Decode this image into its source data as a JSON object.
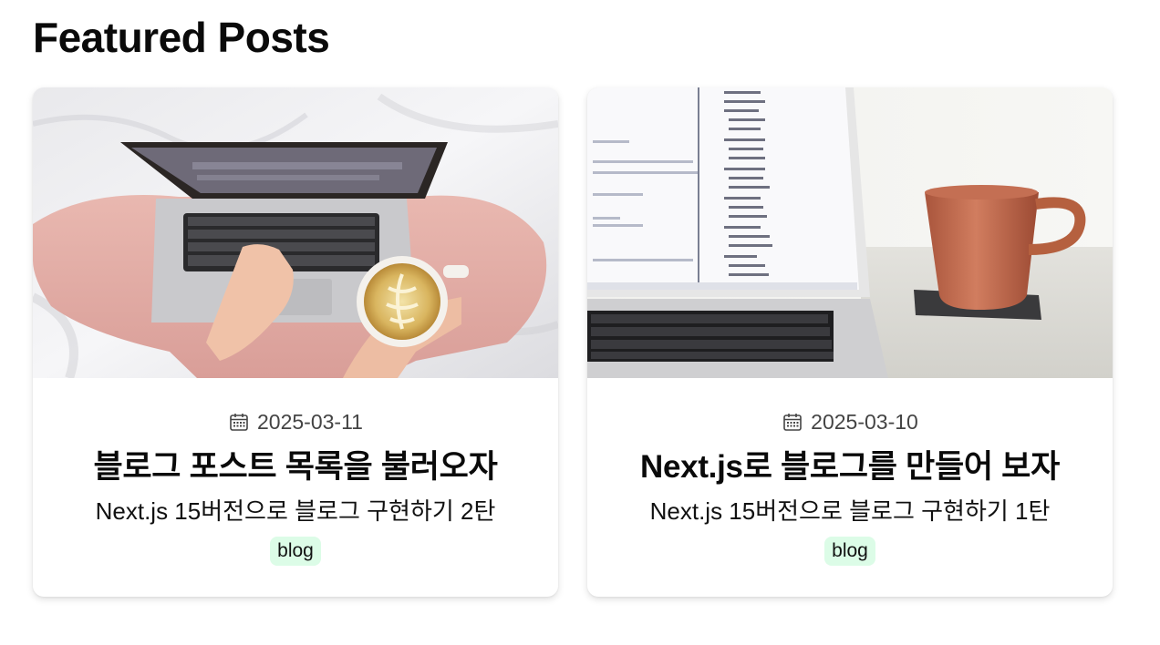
{
  "section": {
    "title": "Featured Posts"
  },
  "posts": [
    {
      "date": "2025-03-11",
      "title": "블로그 포스트 목록을 불러오자",
      "description": "Next.js 15버전으로 블로그 구현하기 2탄",
      "tag": "blog",
      "thumbnail": "laptop-latte-bed-photo"
    },
    {
      "date": "2025-03-10",
      "title": "Next.js로 블로그를 만들어 보자",
      "description": "Next.js 15버전으로 블로그 구현하기 1탄",
      "tag": "blog",
      "thumbnail": "macbook-coffee-mug-photo"
    }
  ],
  "icons": {
    "date": "calendar-icon"
  },
  "colors": {
    "tag_background": "#dcfce7",
    "title_text": "#0a0a0a",
    "date_text": "#444444"
  }
}
